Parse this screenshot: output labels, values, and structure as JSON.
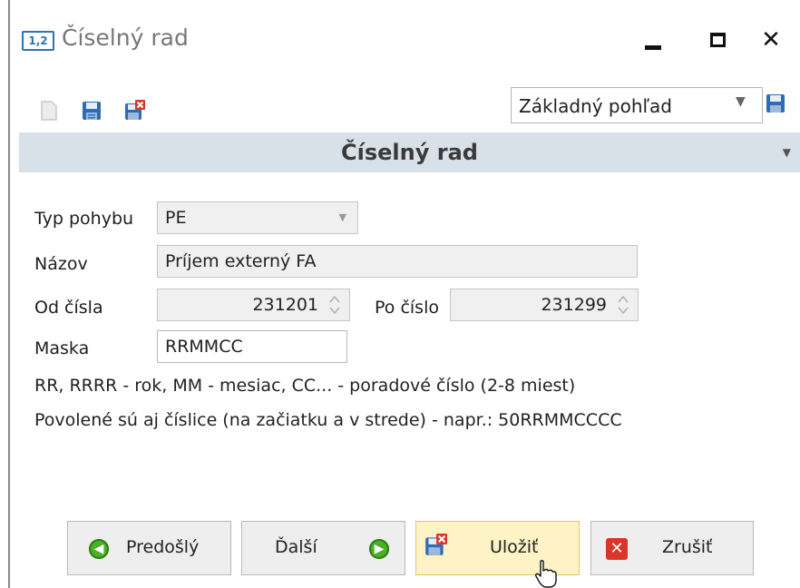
{
  "window": {
    "icon_text": "1,2",
    "title": "Číselný rad",
    "controls": {
      "minimize": "minimize-icon",
      "maximize": "maximize-icon",
      "close": "close-icon"
    }
  },
  "toolbar": {
    "icons": [
      "new-document-icon",
      "save-icon",
      "save-and-close-icon"
    ],
    "view_select_value": "Základný pohľad"
  },
  "section": {
    "title": "Číselný rad"
  },
  "form": {
    "type_label": "Typ pohybu",
    "type_value": "PE",
    "name_label": "Názov",
    "name_value": "Príjem externý FA",
    "from_label": "Od čísla",
    "from_value": "231201",
    "to_label": "Po číslo",
    "to_value": "231299",
    "mask_label": "Maska",
    "mask_value": "RRMMCC"
  },
  "hints": [
    "RR, RRRR - rok, MM - mesiac, CC... - poradové číslo (2-8 miest)",
    "Povolené sú aj číslice (na začiatku a v strede) - napr.: 50RRMMCCCC"
  ],
  "buttons": {
    "previous": "Predošlý",
    "next": "Ďalší",
    "save": "Uložiť",
    "cancel": "Zrušiť"
  },
  "colors": {
    "section_bg": "#d8e0e8",
    "save_btn_bg": "#fdf3c6",
    "accent": "#2e74b5"
  }
}
